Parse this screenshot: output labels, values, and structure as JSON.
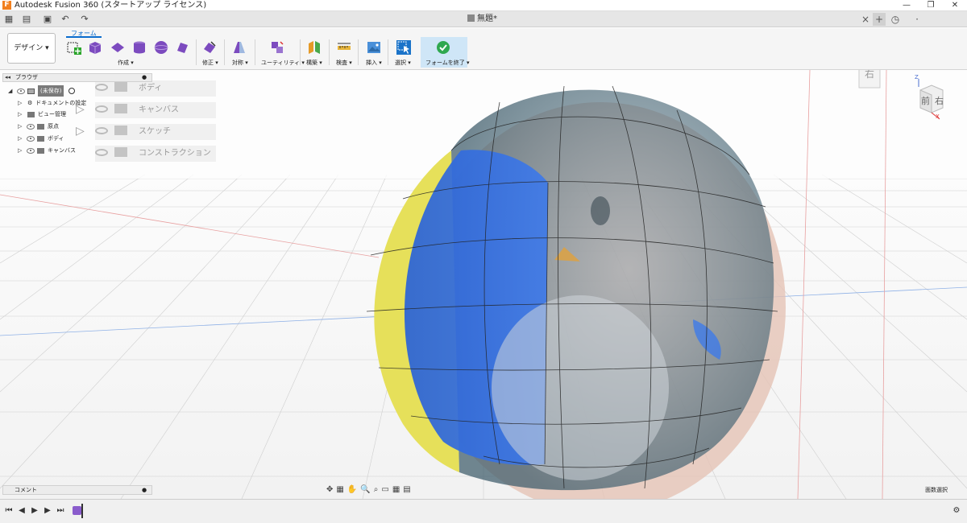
{
  "app": {
    "window_title": "Autodesk Fusion 360 (スタートアップ ライセンス)",
    "logo_letter": "F"
  },
  "window_controls": [
    "—",
    "❐",
    "✕"
  ],
  "document_tab": {
    "title": "無題*"
  },
  "ribbon": {
    "workspace": "デザイン ▾",
    "active_tab": "フォーム",
    "groups": [
      {
        "label": "作成 ▾"
      },
      {
        "label": "修正 ▾"
      },
      {
        "label": "対称 ▾"
      },
      {
        "label": "ユーティリティ ▾"
      },
      {
        "label": "構築 ▾"
      },
      {
        "label": "検査 ▾"
      },
      {
        "label": "挿入 ▾"
      },
      {
        "label": "選択 ▾"
      },
      {
        "label": "フォームを終了 ▾"
      }
    ]
  },
  "browser": {
    "title": "ブラウザ",
    "root": "(未保存)",
    "items": [
      {
        "label": "ドキュメントの設定"
      },
      {
        "label": "ビュー管理"
      },
      {
        "label": "原点"
      },
      {
        "label": "ボディ"
      },
      {
        "label": "キャンバス"
      }
    ]
  },
  "overlay_items": [
    "ボディ",
    "キャンバス",
    "スケッチ",
    "コンストラクション"
  ],
  "comment_bar": {
    "label": "コメント"
  },
  "view_cube": {
    "front": "前",
    "right": "右",
    "ghost_right": "右",
    "axis_z": "Z",
    "axis_x": "X"
  },
  "status": {
    "select_mode": "面数選択"
  },
  "colors": {
    "accent": "#0a6cce",
    "finish_bg": "#cfe6f7",
    "blue_face": "#2f6fe0",
    "yellow_face": "#e6e05a",
    "shell": "#d9a58f",
    "canvas_tint": "#e5c3b5"
  }
}
